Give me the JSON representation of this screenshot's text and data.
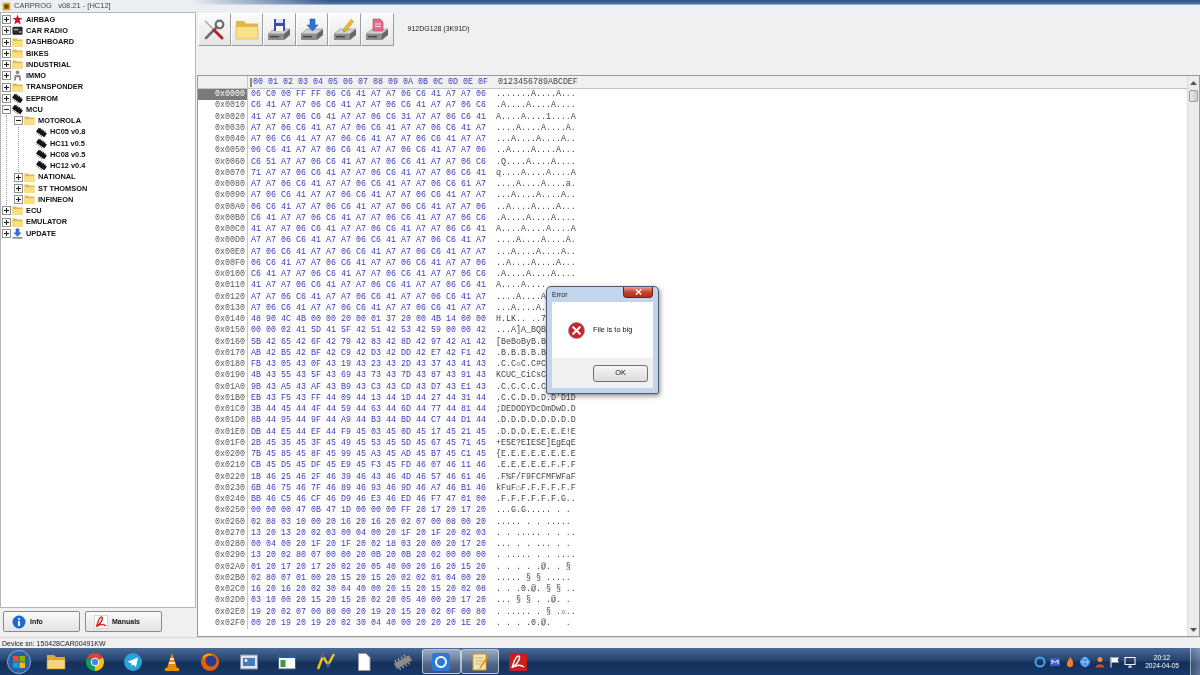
{
  "window": {
    "title": "CARPROG   v08.21 - [HC12]"
  },
  "tree": [
    {
      "label": "AIRBAG",
      "kind": "star",
      "expanded": false
    },
    {
      "label": "CAR RADIO",
      "kind": "radio",
      "expanded": false
    },
    {
      "label": "DASHBOARD",
      "kind": "folder",
      "expanded": false
    },
    {
      "label": "BIKES",
      "kind": "folder",
      "expanded": false
    },
    {
      "label": "INDUSTRIAL",
      "kind": "folder",
      "expanded": false
    },
    {
      "label": "IMMO",
      "kind": "person",
      "expanded": false
    },
    {
      "label": "TRANSPONDER",
      "kind": "folder",
      "expanded": false
    },
    {
      "label": "EEPROM",
      "kind": "chip",
      "expanded": false
    },
    {
      "label": "MCU",
      "kind": "chip",
      "expanded": true,
      "children": [
        {
          "label": "MOTOROLA",
          "kind": "folder",
          "expanded": true,
          "children": [
            {
              "label": "HC05 v0.8",
              "kind": "chip"
            },
            {
              "label": "HC11 v0.5",
              "kind": "chip"
            },
            {
              "label": "HC08 v0.5",
              "kind": "chip"
            },
            {
              "label": "HC12 v0.4",
              "kind": "chip"
            }
          ]
        },
        {
          "label": "NATIONAL",
          "kind": "folder",
          "expanded": false
        },
        {
          "label": "ST THOMSON",
          "kind": "folder",
          "expanded": false
        },
        {
          "label": "INFINEON",
          "kind": "folder",
          "expanded": false
        }
      ]
    },
    {
      "label": "ECU",
      "kind": "folder",
      "expanded": false
    },
    {
      "label": "EMULATOR",
      "kind": "folder",
      "expanded": false
    },
    {
      "label": "UPDATE",
      "kind": "update",
      "expanded": false
    }
  ],
  "side_buttons": [
    {
      "kind": "info",
      "label": "Info"
    },
    {
      "kind": "manuals",
      "label": "Manuals"
    }
  ],
  "toolbar": {
    "buttons": [
      {
        "kind": "tools"
      },
      {
        "kind": "folder"
      },
      {
        "kind": "floppy"
      },
      {
        "kind": "drive-arrow"
      },
      {
        "kind": "drive-pencil"
      },
      {
        "kind": "drive-page"
      }
    ],
    "device_label": "912DG128 (3K91D)"
  },
  "hex_view": {
    "header_bytes": "00 01 02 03 04 05 06 07 08 09 0A 0B 0C 0D 0E 0F",
    "header_ascii": "0123456789ABCDEF",
    "rows": [
      {
        "address": "0x0000",
        "bytes": "06 C0 00 FF FF 06 C6 41 A7 A7 06 C6 41 A7 A7 06",
        "ascii": ".......A....A...",
        "selected": true
      },
      {
        "address": "0x0010",
        "bytes": "C6 41 A7 A7 06 C6 41 A7 A7 06 C6 41 A7 A7 06 C6",
        "ascii": ".A....A....A....",
        "selected": false
      },
      {
        "address": "0x0020",
        "bytes": "41 A7 A7 06 C6 41 A7 A7 06 C6 31 A7 A7 06 C6 41",
        "ascii": "A....A....1....A",
        "selected": false
      },
      {
        "address": "0x0030",
        "bytes": "A7 A7 06 C6 41 A7 A7 06 C6 41 A7 A7 06 C6 41 A7",
        "ascii": "....A....A....A.",
        "selected": false
      },
      {
        "address": "0x0040",
        "bytes": "A7 06 C6 41 A7 A7 06 C6 41 A7 A7 06 C6 41 A7 A7",
        "ascii": "...A....A....A..",
        "selected": false
      },
      {
        "address": "0x0050",
        "bytes": "06 C6 41 A7 A7 06 C6 41 A7 A7 06 C6 41 A7 A7 06",
        "ascii": "..A....A....A...",
        "selected": false
      },
      {
        "address": "0x0060",
        "bytes": "C6 51 A7 A7 06 C6 41 A7 A7 06 C6 41 A7 A7 06 C6",
        "ascii": ".Q....A....A....",
        "selected": false
      },
      {
        "address": "0x0070",
        "bytes": "71 A7 A7 06 C6 41 A7 A7 06 C6 41 A7 A7 06 C6 41",
        "ascii": "q....A....A....A",
        "selected": false
      },
      {
        "address": "0x0080",
        "bytes": "A7 A7 06 C6 41 A7 A7 06 C6 41 A7 A7 06 C6 61 A7",
        "ascii": "....A....A....a.",
        "selected": false
      },
      {
        "address": "0x0090",
        "bytes": "A7 06 C6 41 A7 A7 06 C6 41 A7 A7 06 C6 41 A7 A7",
        "ascii": "...A....A....A..",
        "selected": false
      },
      {
        "address": "0x00A0",
        "bytes": "06 C6 41 A7 A7 06 C6 41 A7 A7 06 C6 41 A7 A7 06",
        "ascii": "..A....A....A...",
        "selected": false
      },
      {
        "address": "0x00B0",
        "bytes": "C6 41 A7 A7 06 C6 41 A7 A7 06 C6 41 A7 A7 06 C6",
        "ascii": ".A....A....A....",
        "selected": false
      },
      {
        "address": "0x00C0",
        "bytes": "41 A7 A7 06 C6 41 A7 A7 06 C6 41 A7 A7 06 C6 41",
        "ascii": "A....A....A....A",
        "selected": false
      },
      {
        "address": "0x00D0",
        "bytes": "A7 A7 06 C6 41 A7 A7 06 C6 41 A7 A7 06 C6 41 A7",
        "ascii": "....A....A....A.",
        "selected": false
      },
      {
        "address": "0x00E0",
        "bytes": "A7 06 C6 41 A7 A7 06 C6 41 A7 A7 06 C6 41 A7 A7",
        "ascii": "...A....A....A..",
        "selected": false
      },
      {
        "address": "0x00F0",
        "bytes": "06 C6 41 A7 A7 06 C6 41 A7 A7 06 C6 41 A7 A7 06",
        "ascii": "..A....A....A...",
        "selected": false
      },
      {
        "address": "0x0100",
        "bytes": "C6 41 A7 A7 06 C6 41 A7 A7 06 C6 41 A7 A7 06 C6",
        "ascii": ".A....A....A....",
        "selected": false
      },
      {
        "address": "0x0110",
        "bytes": "41 A7 A7 06 C6 41 A7 A7 06 C6 41 A7 A7 06 C6 41",
        "ascii": "A....A....",
        "selected": false
      },
      {
        "address": "0x0120",
        "bytes": "A7 A7 06 C6 41 A7 A7 06 C6 41 A7 A7 06 C6 41 A7",
        "ascii": "....A....A",
        "selected": false
      },
      {
        "address": "0x0130",
        "bytes": "A7 06 C6 41 A7 A7 06 C6 41 A7 A7 06 C6 41 A7 A7",
        "ascii": "...A....A.",
        "selected": false
      },
      {
        "address": "0x0140",
        "bytes": "48 90 4C 4B 00 00 20 00 01 37 20 00 4B 14 00 00",
        "ascii": "H.LK.. ..7",
        "selected": false
      },
      {
        "address": "0x0150",
        "bytes": "00 00 02 41 5D 41 5F 42 51 42 53 42 59 00 00 42",
        "ascii": "...A]A_BQB",
        "selected": false
      },
      {
        "address": "0x0160",
        "bytes": "5B 42 65 42 6F 42 79 42 83 42 8D 42 97 42 A1 42",
        "ascii": "[BeBoByB.B",
        "selected": false
      },
      {
        "address": "0x0170",
        "bytes": "AB 42 B5 42 BF 42 C9 42 D3 42 DD 42 E7 42 F1 42",
        "ascii": ".B.B.B.B.B",
        "selected": false
      },
      {
        "address": "0x0180",
        "bytes": "FB 43 05 43 0F 43 19 43 23 43 2D 43 37 43 41 43",
        "ascii": ".C.C☼C.C#C",
        "selected": false
      },
      {
        "address": "0x0190",
        "bytes": "4B 43 55 43 5F 43 69 43 73 43 7D 43 87 43 91 43",
        "ascii": "KCUC_CiCsC",
        "selected": false
      },
      {
        "address": "0x01A0",
        "bytes": "9B 43 A5 43 AF 43 B9 43 C3 43 CD 43 D7 43 E1 43",
        "ascii": ".C.C.C.C.C",
        "selected": false
      },
      {
        "address": "0x01B0",
        "bytes": "EB 43 F5 43 FF 44 09 44 13 44 1D 44 27 44 31 44",
        "ascii": ".C.C.D.D.D.D'D1D",
        "selected": false
      },
      {
        "address": "0x01C0",
        "bytes": "3B 44 45 44 4F 44 59 44 63 44 6D 44 77 44 81 44",
        "ascii": ";DEDODYDcDmDwD.D",
        "selected": false
      },
      {
        "address": "0x01D0",
        "bytes": "8B 44 95 44 9F 44 A9 44 B3 44 BD 44 C7 44 D1 44",
        "ascii": ".D.D.D.D.D.D.D.D",
        "selected": false
      },
      {
        "address": "0x01E0",
        "bytes": "DB 44 E5 44 EF 44 F9 45 03 45 0D 45 17 45 21 45",
        "ascii": ".D.D.D.E.E.E.E!E",
        "selected": false
      },
      {
        "address": "0x01F0",
        "bytes": "2B 45 35 45 3F 45 49 45 53 45 5D 45 67 45 71 45",
        "ascii": "+E5E?EIESE]EgEqE",
        "selected": false
      },
      {
        "address": "0x0200",
        "bytes": "7B 45 85 45 8F 45 99 45 A3 45 AD 45 B7 45 C1 45",
        "ascii": "{E.E.E.E.E.E.E.E",
        "selected": false
      },
      {
        "address": "0x0210",
        "bytes": "CB 45 D5 45 DF 45 E9 45 F3 45 FD 46 07 46 11 46",
        "ascii": ".E.E.E.E.E.F.F.F",
        "selected": false
      },
      {
        "address": "0x0220",
        "bytes": "1B 46 25 46 2F 46 39 46 43 46 4D 46 57 46 61 46",
        "ascii": ".F%F/F9FCFMFWFaF",
        "selected": false
      },
      {
        "address": "0x0230",
        "bytes": "6B 46 75 46 7F 46 89 46 93 46 9D 46 A7 46 B1 46",
        "ascii": "kFuF⌂F.F.F.F.F.F",
        "selected": false
      },
      {
        "address": "0x0240",
        "bytes": "BB 46 C5 46 CF 46 D9 46 E3 46 ED 46 F7 47 01 00",
        "ascii": ".F.F.F.F.F.F.G..",
        "selected": false
      },
      {
        "address": "0x0250",
        "bytes": "00 00 00 47 0B 47 1D 00 00 00 FF 20 17 20 17 20",
        "ascii": "...G.G..... . .",
        "selected": false
      },
      {
        "address": "0x0260",
        "bytes": "02 08 03 10 00 20 16 20 16 20 02 07 00 08 00 20",
        "ascii": "..... . . .....",
        "selected": false
      },
      {
        "address": "0x0270",
        "bytes": "13 20 13 20 02 03 00 04 00 20 1F 20 1F 20 02 03",
        "ascii": ". . ..... . . ..",
        "selected": false
      },
      {
        "address": "0x0280",
        "bytes": "00 04 00 20 1F 20 1F 20 02 18 03 20 00 20 17 20",
        "ascii": "... . . ... . .",
        "selected": false
      },
      {
        "address": "0x0290",
        "bytes": "13 20 02 80 07 00 00 20 0B 20 0B 20 02 00 00 00",
        "ascii": ". ..... . . ....",
        "selected": false
      },
      {
        "address": "0x02A0",
        "bytes": "01 20 17 20 17 20 02 20 05 40 00 20 16 20 15 20",
        "ascii": ". . . . .@. . §",
        "selected": false
      },
      {
        "address": "0x02B0",
        "bytes": "02 80 07 01 00 20 15 20 15 20 02 02 01 04 00 20",
        "ascii": "..... § § .....",
        "selected": false
      },
      {
        "address": "0x02C0",
        "bytes": "16 20 16 20 02 30 04 40 00 20 15 20 15 20 02 08",
        "ascii": ". . .0.@. § § ..",
        "selected": false
      },
      {
        "address": "0x02D0",
        "bytes": "03 10 00 20 15 20 15 20 02 20 05 40 00 20 17 20",
        "ascii": "... § § . .@. .",
        "selected": false
      },
      {
        "address": "0x02E0",
        "bytes": "19 20 02 07 00 80 00 20 19 20 15 20 02 0F 00 80",
        "ascii": ". ..... . § .☼..",
        "selected": false
      },
      {
        "address": "0x02F0",
        "bytes": "00 20 19 20 19 20 02 30 04 40 00 20 20 20 1E 20",
        "ascii": ". . . .0.@.   .",
        "selected": false
      }
    ]
  },
  "dialog": {
    "title": "Error",
    "message": "File is to big",
    "button": "OK"
  },
  "status_bar": {
    "text": "Device sn: 150428CAR00491KW"
  },
  "taskbar": {
    "apps": [
      {
        "kind": "folder",
        "running": false
      },
      {
        "kind": "wheel",
        "running": false
      },
      {
        "kind": "plane",
        "running": false
      },
      {
        "kind": "cone",
        "running": false
      },
      {
        "kind": "disc",
        "running": false
      },
      {
        "kind": "picture",
        "running": false
      },
      {
        "kind": "window",
        "running": false
      },
      {
        "kind": "zigzag",
        "running": false
      },
      {
        "kind": "document",
        "running": false
      },
      {
        "kind": "chip",
        "running": false
      },
      {
        "kind": "tile",
        "running": true
      },
      {
        "kind": "notepad",
        "running": true
      },
      {
        "kind": "swirl",
        "running": false
      }
    ],
    "time": "20:12",
    "date": "2024-04-05"
  }
}
